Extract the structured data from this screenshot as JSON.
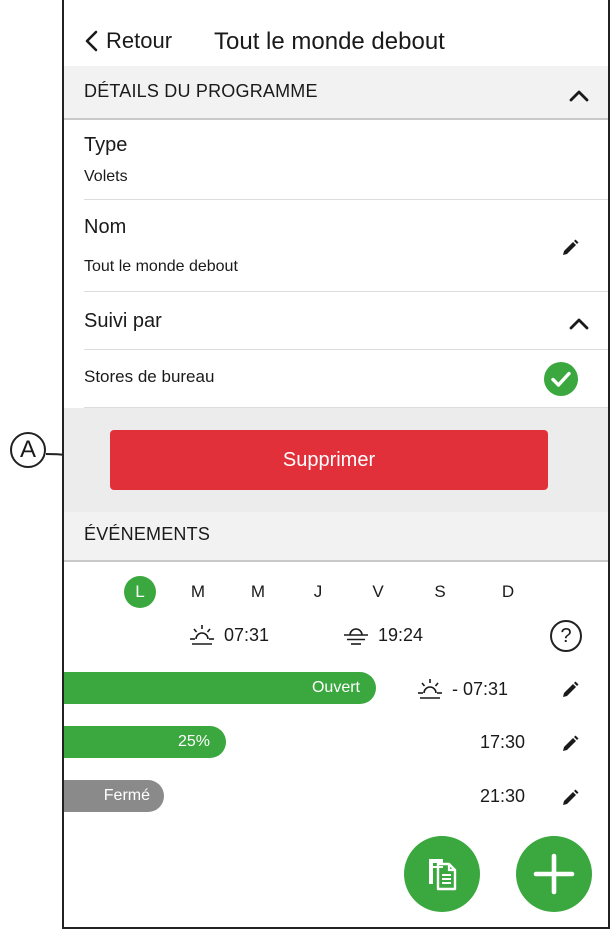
{
  "callout": {
    "letter": "A"
  },
  "header": {
    "back_label": "Retour",
    "title": "Tout le monde debout"
  },
  "details": {
    "section_title": "DÉTAILS DU PROGRAMME",
    "type_label": "Type",
    "type_value": "Volets",
    "name_label": "Nom",
    "name_value": "Tout le monde debout",
    "followed_label": "Suivi par",
    "followed_item": "Stores de bureau"
  },
  "actions": {
    "delete_label": "Supprimer"
  },
  "events": {
    "section_title": "ÉVÉNEMENTS",
    "days": [
      {
        "label": "L",
        "active": true
      },
      {
        "label": "M",
        "active": false
      },
      {
        "label": "M",
        "active": false
      },
      {
        "label": "J",
        "active": false
      },
      {
        "label": "V",
        "active": false
      },
      {
        "label": "S",
        "active": false
      },
      {
        "label": "D",
        "active": false
      }
    ],
    "sunrise_time": "07:31",
    "sunset_time": "19:24",
    "help_label": "?",
    "items": [
      {
        "label": "Ouvert",
        "level": 1.0,
        "time": "- 07:31",
        "sunrise_icon": true
      },
      {
        "label": "25%",
        "level": 0.25,
        "time": "17:30",
        "sunrise_icon": false
      },
      {
        "label": "Fermé",
        "level": 0.0,
        "time": "21:30",
        "sunrise_icon": false
      }
    ]
  },
  "colors": {
    "accent": "#3aa83e",
    "danger": "#e1303a",
    "closed": "#8a8a8a"
  },
  "icons": [
    "chevron-left-icon",
    "chevron-up-icon",
    "pencil-icon",
    "check-circle-icon",
    "sunrise-icon",
    "sunset-icon",
    "help-icon",
    "copy-icon",
    "plus-icon"
  ]
}
